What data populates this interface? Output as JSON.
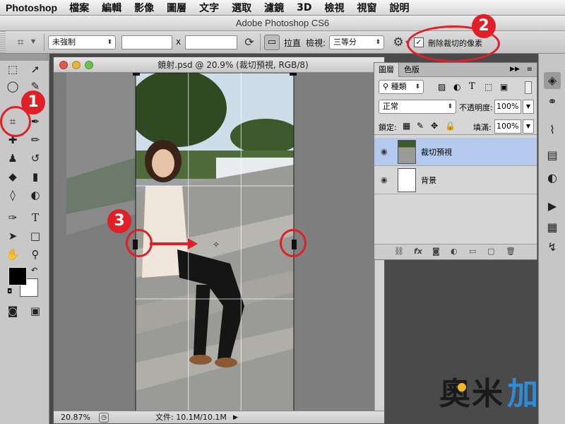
{
  "menubar": {
    "app_name": "Photoshop",
    "items": [
      "檔案",
      "編輯",
      "影像",
      "圖層",
      "文字",
      "選取",
      "濾鏡",
      "3D",
      "檢視",
      "視窗",
      "說明"
    ]
  },
  "window_title": "Adobe Photoshop CS6",
  "options_bar": {
    "ratio_select": "未強制",
    "ratio_x_value": "",
    "ratio_y_value": "",
    "times_sign": "x",
    "straighten_label": "拉直",
    "view_label": "檢視:",
    "view_select": "三等分",
    "delete_cropped_checked": true,
    "delete_cropped_label": "刪除裁切的像素"
  },
  "document": {
    "title": "鏡射.psd @ 20.9% (裁切預視, RGB/8)",
    "zoom": "20.87%",
    "file_info": "文件: 10.1M/10.1M"
  },
  "layers_panel": {
    "tabs": [
      "圖層",
      "色版"
    ],
    "filter_kind": "種類",
    "blend_mode": "正常",
    "opacity_label": "不透明度:",
    "opacity_value": "100%",
    "lock_label": "鎖定:",
    "fill_label": "填滿:",
    "fill_value": "100%",
    "layers": [
      {
        "name": "裁切預視",
        "selected": true
      },
      {
        "name": "背景",
        "selected": false
      }
    ]
  },
  "annotations": {
    "badges": [
      "1",
      "2",
      "3"
    ],
    "watermark": "奧米加"
  },
  "colors": {
    "annotation_red": "#e01f26",
    "selected_layer": "#b5c9ef"
  }
}
